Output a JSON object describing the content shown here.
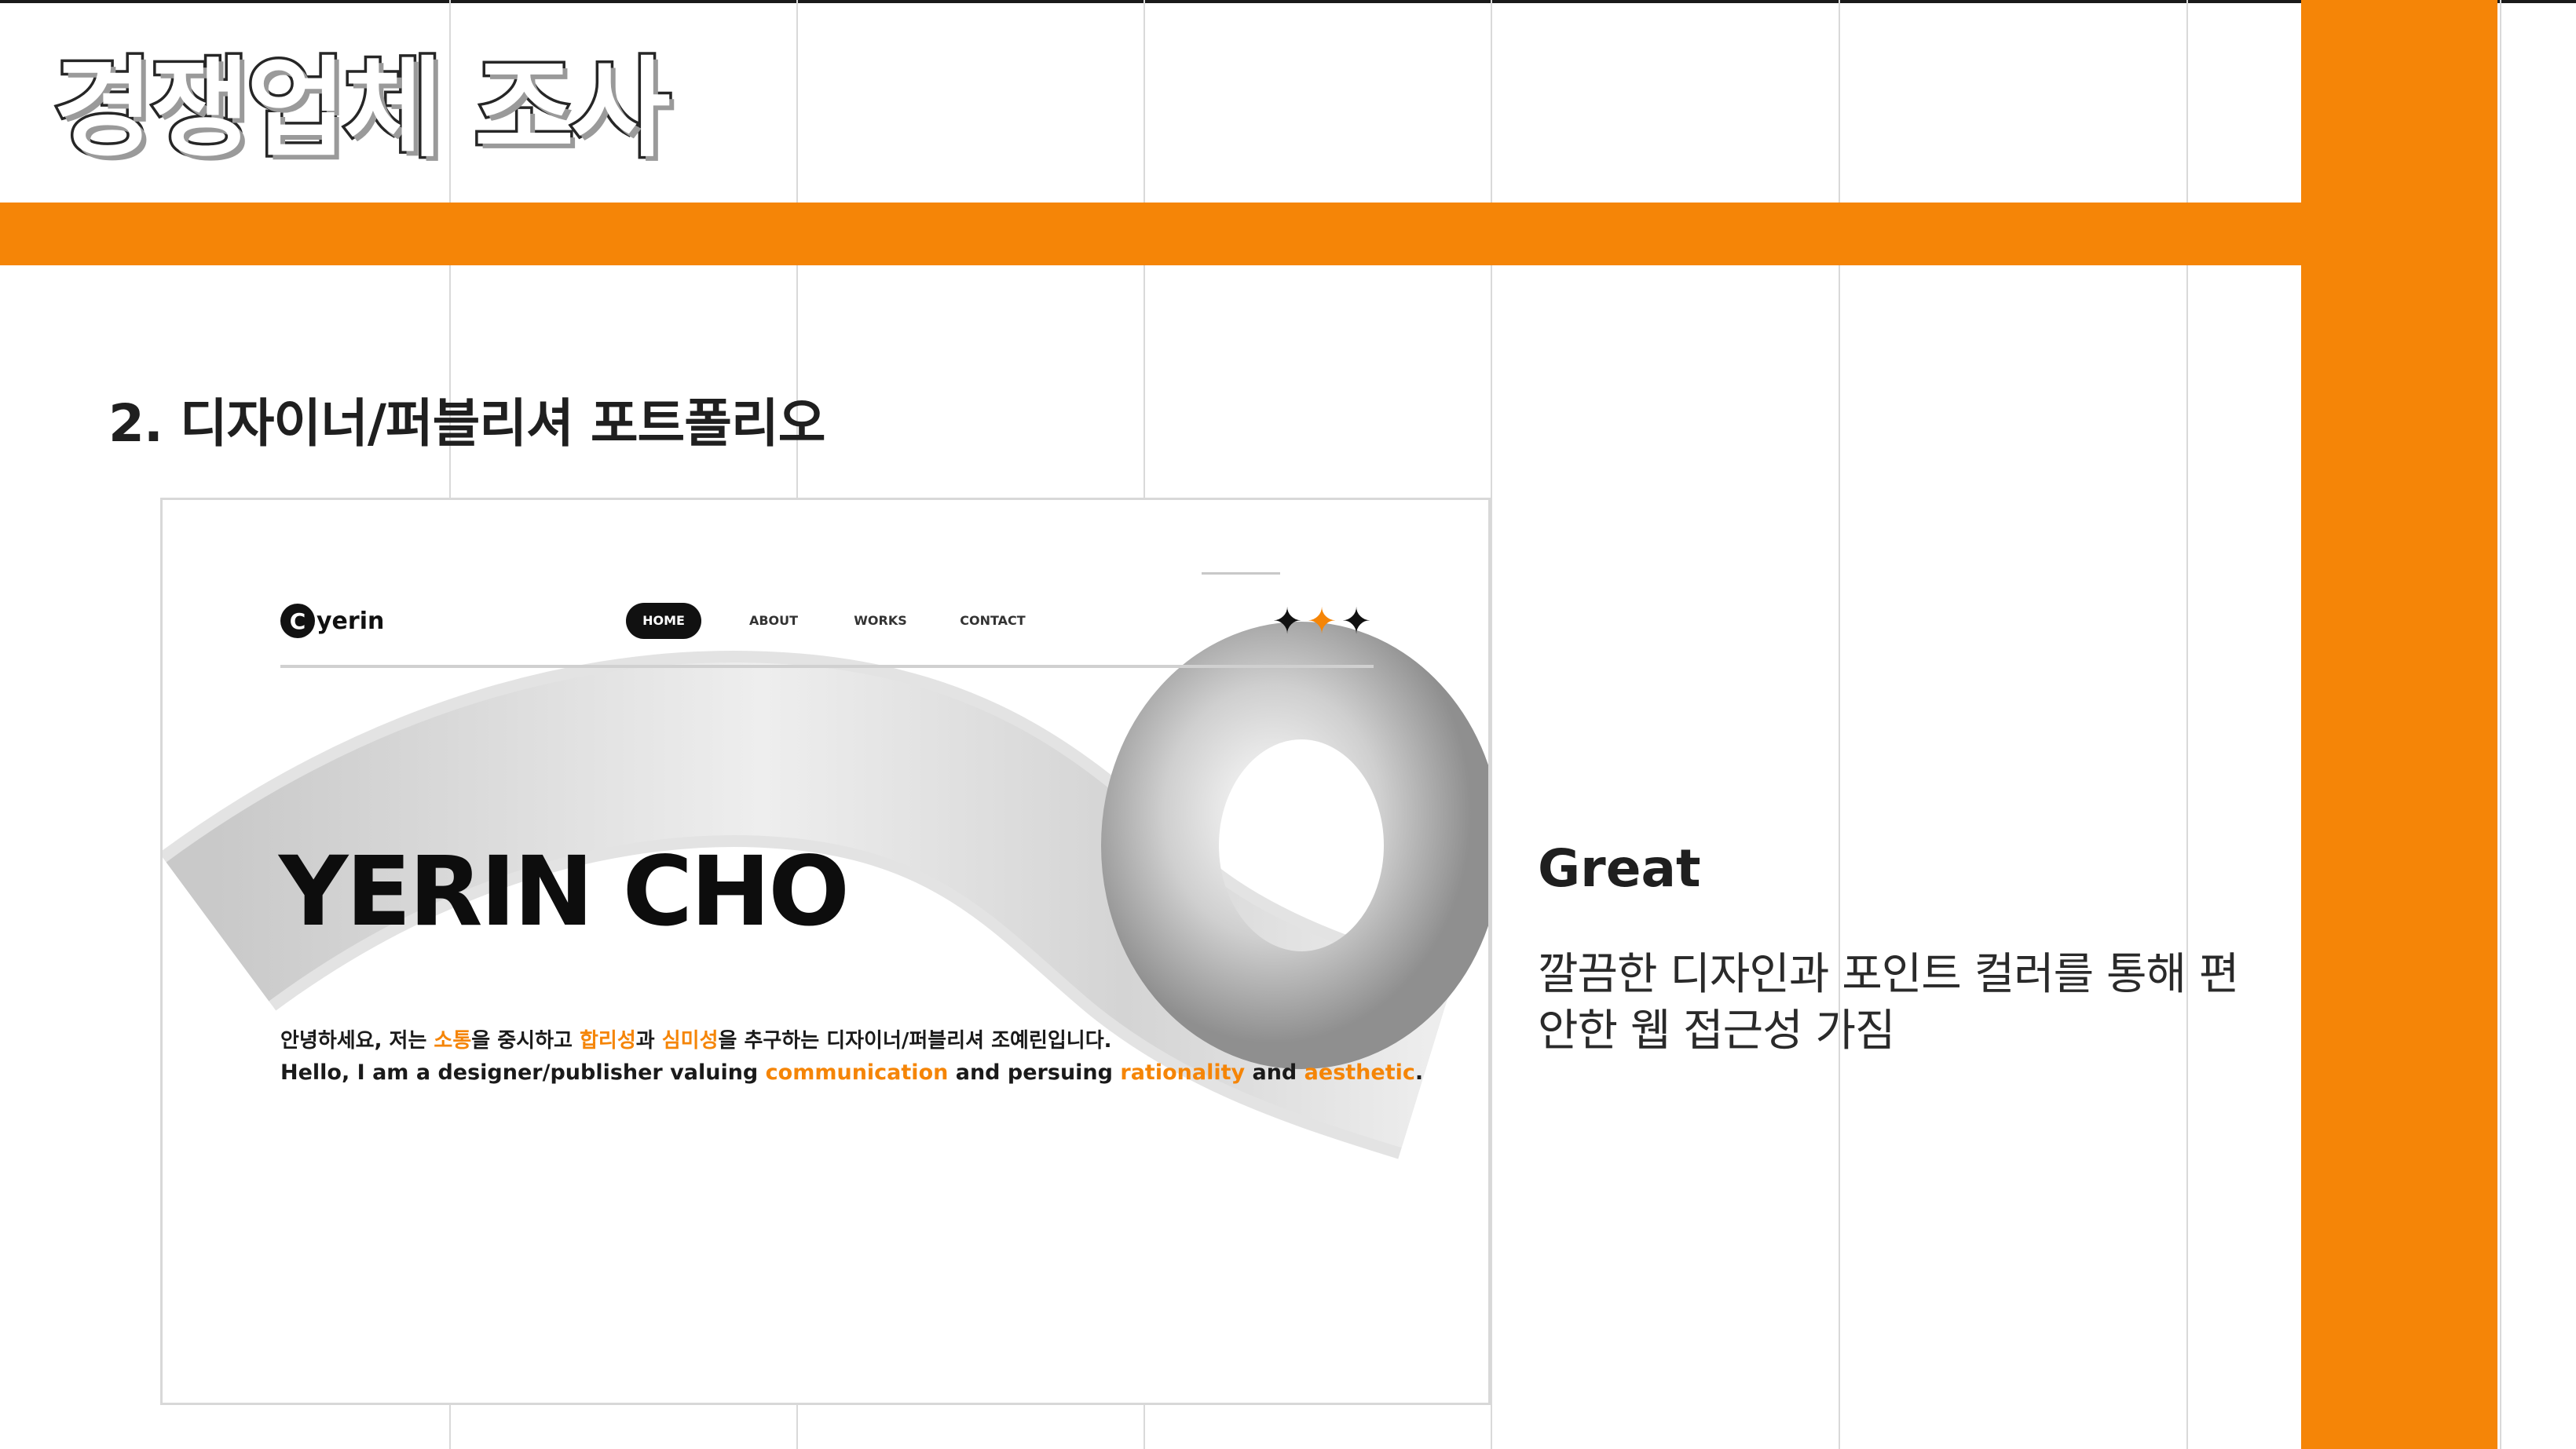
{
  "slide": {
    "title": "경쟁업체 조사",
    "section_heading": "2. 디자이너/퍼블리셔 포트폴리오"
  },
  "colors": {
    "accent": "#f58507",
    "text": "#1f1f1f",
    "grid": "#d9d9d9"
  },
  "portfolio": {
    "logo_mark": "C",
    "logo_text": "yerin",
    "nav": {
      "home": "HOME",
      "about": "ABOUT",
      "works": "WORKS",
      "contact": "CONTACT"
    },
    "decor_icons": [
      "star-icon",
      "star-icon",
      "star-icon"
    ],
    "hero_name": "YERIN CHO",
    "intro_ko": {
      "p1": "안녕하세요, 저는 ",
      "h1": "소통",
      "p2": "을 중시하고 ",
      "h2": "합리성",
      "p3": "과 ",
      "h3": "심미성",
      "p4": "을 추구하는 디자이너/퍼블리셔 조예린입니다."
    },
    "intro_en": {
      "p1": "Hello, I am a designer/publisher valuing ",
      "h1": "communication",
      "p2": " and persuing ",
      "h2": "rationality",
      "p3": " and ",
      "h3": "aesthetic",
      "p4": "."
    }
  },
  "verdict": {
    "title": "Great",
    "body": "깔끔한 디자인과 포인트 컬러를 통해 편안한 웹 접근성 가짐"
  }
}
